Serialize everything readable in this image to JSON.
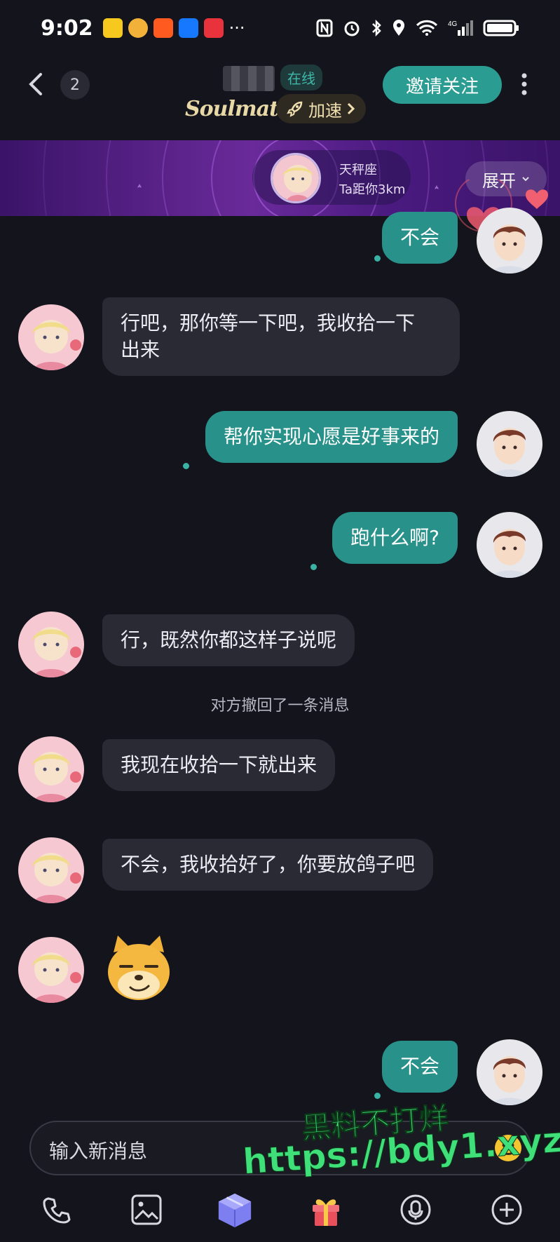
{
  "status_bar": {
    "time": "9:02",
    "more": "···",
    "network": "4G"
  },
  "header": {
    "unread_count": "2",
    "online_status": "在线",
    "brand": "Soulmate",
    "speedup_label": "加速",
    "invite_follow_label": "邀请关注"
  },
  "banner": {
    "zodiac": "天秤座",
    "distance": "Ta距你3km",
    "expand_label": "展开"
  },
  "messages": [
    {
      "side": "right",
      "text": "不会"
    },
    {
      "side": "left",
      "text_line1": "行吧，那你等一下吧，我收拾一下",
      "text_line2": "出来"
    },
    {
      "side": "right",
      "text": "帮你实现心愿是好事来的"
    },
    {
      "side": "right",
      "text": "跑什么啊?"
    },
    {
      "side": "left",
      "text": "行，既然你都这样子说呢"
    },
    {
      "side": "left",
      "text": "我现在收拾一下就出来"
    },
    {
      "side": "left",
      "text": "不会，我收拾好了，你要放鸽子吧"
    },
    {
      "side": "left",
      "sticker": "doge-smirk-sticker"
    },
    {
      "side": "right",
      "text": "不会"
    }
  ],
  "system_notice": "对方撤回了一条消息",
  "input": {
    "placeholder": "输入新消息"
  },
  "watermark": {
    "line1": "黑料不打烊",
    "line2": "https://bdy1.xyz"
  },
  "toolbar": [
    "phone-icon",
    "image-icon",
    "soul-box-icon",
    "gift-icon",
    "voice-icon",
    "plus-icon"
  ],
  "colors": {
    "background": "#14141c",
    "accent_teal": "#27918a",
    "bubble_left": "#2a2a35",
    "banner_purple": "#5a2290",
    "watermark_green": "#3fe07a"
  }
}
